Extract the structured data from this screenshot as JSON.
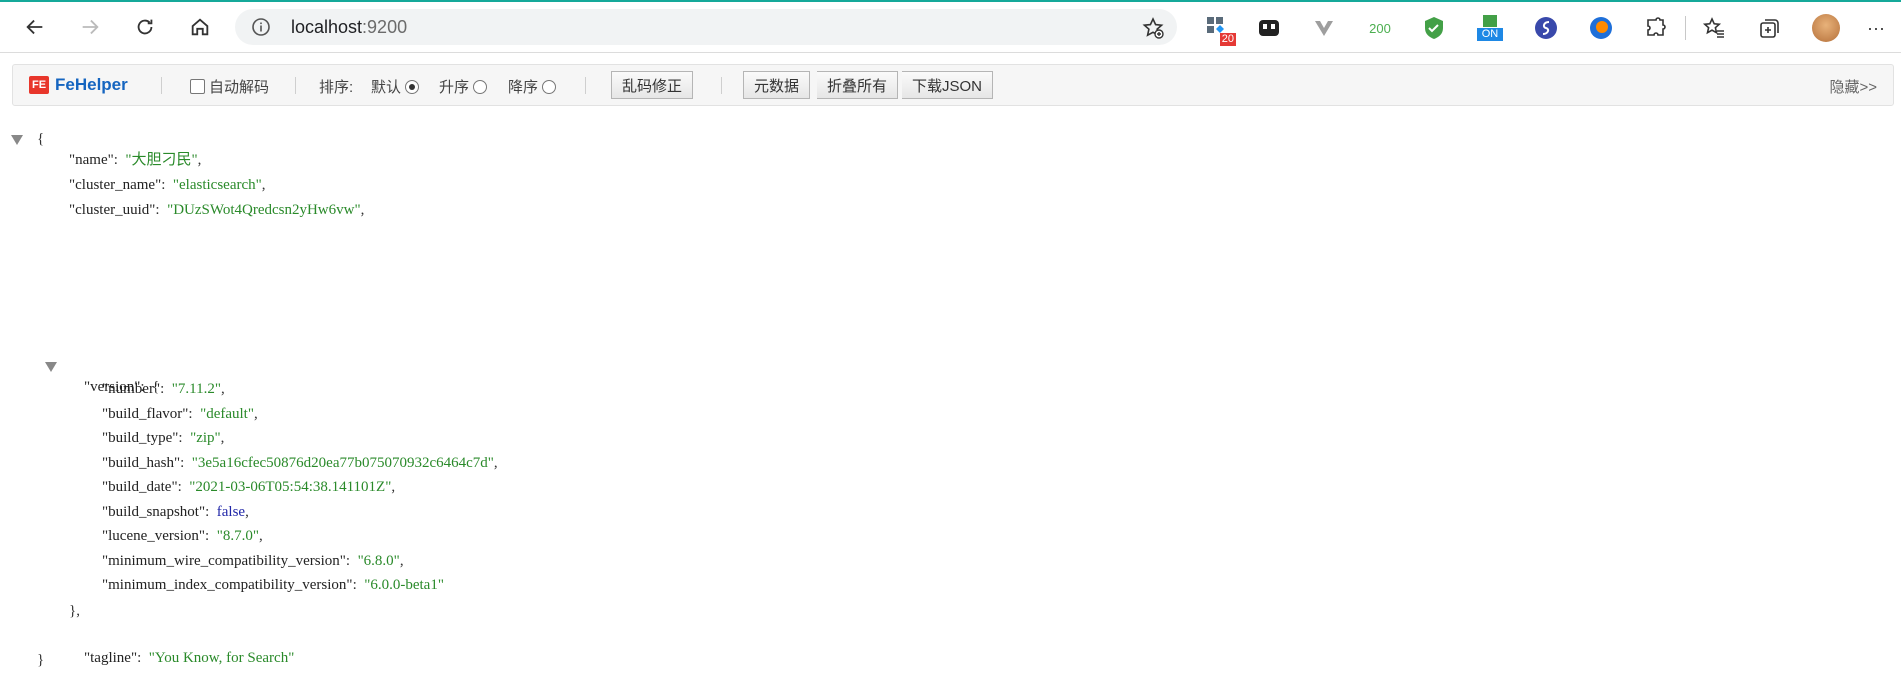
{
  "browser": {
    "url_host": "localhost",
    "url_port": ":9200",
    "extensions": [
      {
        "icon": "tab-manager-icon",
        "badge": "20"
      },
      {
        "icon": "fehelper-icon"
      },
      {
        "icon": "vue-devtools-icon"
      },
      {
        "icon": "status-counter-icon",
        "text": "200"
      },
      {
        "icon": "shield-icon"
      },
      {
        "icon": "on-toggle-icon",
        "badge": "ON"
      },
      {
        "icon": "blue-s-icon"
      },
      {
        "icon": "firefox-relay-icon"
      },
      {
        "icon": "extensions-puzzle-icon"
      },
      {
        "icon": "favorites-icon"
      },
      {
        "icon": "collections-icon"
      },
      {
        "icon": "profile-avatar-icon"
      },
      {
        "icon": "more-menu-icon"
      }
    ]
  },
  "fehelper": {
    "logo": "FeHelper",
    "auto_decode": "自动解码",
    "sort_label": "排序:",
    "sort_default": "默认",
    "sort_asc": "升序",
    "sort_desc": "降序",
    "fix_encoding": "乱码修正",
    "raw_data": "元数据",
    "collapse_all": "折叠所有",
    "download_json": "下载JSON",
    "hide": "隐藏>>"
  },
  "json": {
    "open_brace": "{",
    "lines": [
      {
        "key": "\"name\"",
        "value": "\"大胆刁民\"",
        "type": "string",
        "comma": ","
      },
      {
        "key": "\"cluster_name\"",
        "value": "\"elasticsearch\"",
        "type": "string",
        "comma": ","
      },
      {
        "key": "\"cluster_uuid\"",
        "value": "\"DUzSWot4Qredcsn2yHw6vw\"",
        "type": "string",
        "comma": ","
      }
    ],
    "version_key": "\"version\"",
    "version_open": "{",
    "version_lines": [
      {
        "key": "\"number\"",
        "value": "\"7.11.2\"",
        "type": "string",
        "comma": ","
      },
      {
        "key": "\"build_flavor\"",
        "value": "\"default\"",
        "type": "string",
        "comma": ","
      },
      {
        "key": "\"build_type\"",
        "value": "\"zip\"",
        "type": "string",
        "comma": ","
      },
      {
        "key": "\"build_hash\"",
        "value": "\"3e5a16cfec50876d20ea77b075070932c6464c7d\"",
        "type": "string",
        "comma": ","
      },
      {
        "key": "\"build_date\"",
        "value": "\"2021-03-06T05:54:38.141101Z\"",
        "type": "string",
        "comma": ","
      },
      {
        "key": "\"build_snapshot\"",
        "value": "false",
        "type": "bool",
        "comma": ","
      },
      {
        "key": "\"lucene_version\"",
        "value": "\"8.7.0\"",
        "type": "string",
        "comma": ","
      },
      {
        "key": "\"minimum_wire_compatibility_version\"",
        "value": "\"6.8.0\"",
        "type": "string",
        "comma": ","
      },
      {
        "key": "\"minimum_index_compatibility_version\"",
        "value": "\"6.0.0-beta1\"",
        "type": "string",
        "comma": ""
      }
    ],
    "version_close": "},",
    "tagline_key": "\"tagline\"",
    "tagline_value": "\"You Know, for Search\"",
    "close_brace": "}"
  },
  "colors": {
    "string": "#2a8a2a",
    "bool": "#2127a8",
    "accent": "#15a99a"
  }
}
